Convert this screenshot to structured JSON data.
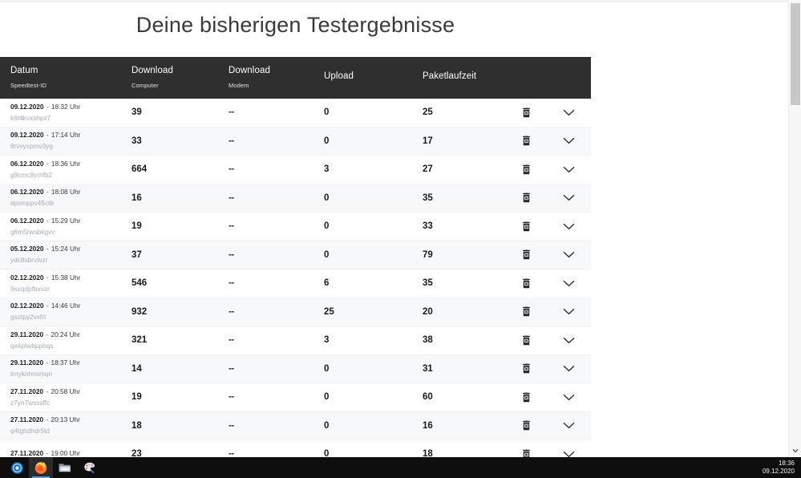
{
  "page": {
    "title": "Deine bisherigen Testergebnisse"
  },
  "table": {
    "headers": [
      {
        "main": "Datum",
        "sub": "Speedtest-ID"
      },
      {
        "main": "Download",
        "sub": "Computer"
      },
      {
        "main": "Download",
        "sub": "Modem"
      },
      {
        "main": "Upload",
        "sub": ""
      },
      {
        "main": "Paketlaufzeit",
        "sub": ""
      }
    ],
    "icons": {
      "delete": "trash-icon",
      "expand": "chevron-down-icon"
    },
    "rows": [
      {
        "date": "09.12.2020",
        "sep": "-",
        "time": "18:32 Uhr",
        "id": "k6t4kvxshpx7",
        "dl_computer": "39",
        "dl_modem": "--",
        "upload": "0",
        "paketlaufzeit": "25"
      },
      {
        "date": "09.12.2020",
        "sep": "-",
        "time": "17:14 Uhr",
        "id": "8rvvyxpmv3yg",
        "dl_computer": "33",
        "dl_modem": "--",
        "upload": "0",
        "paketlaufzeit": "17"
      },
      {
        "date": "06.12.2020",
        "sep": "-",
        "time": "18:36 Uhr",
        "id": "g9cmc9yrhfb2",
        "dl_computer": "664",
        "dl_modem": "--",
        "upload": "3",
        "paketlaufzeit": "27"
      },
      {
        "date": "06.12.2020",
        "sep": "-",
        "time": "18:08 Uhr",
        "id": "dpsmppv45ctb",
        "dl_computer": "16",
        "dl_modem": "--",
        "upload": "0",
        "paketlaufzeit": "35"
      },
      {
        "date": "06.12.2020",
        "sep": "-",
        "time": "15:29 Uhr",
        "id": "g6m5rwsbkgvv",
        "dl_computer": "19",
        "dl_modem": "--",
        "upload": "0",
        "paketlaufzeit": "33"
      },
      {
        "date": "05.12.2020",
        "sep": "-",
        "time": "15:24 Uhr",
        "id": "ydc8xbrvtvzr",
        "dl_computer": "37",
        "dl_modem": "--",
        "upload": "0",
        "paketlaufzeit": "79"
      },
      {
        "date": "02.12.2020",
        "sep": "-",
        "time": "15:38 Uhr",
        "id": "9sxqdpfbxvzr",
        "dl_computer": "546",
        "dl_modem": "--",
        "upload": "6",
        "paketlaufzeit": "35"
      },
      {
        "date": "02.12.2020",
        "sep": "-",
        "time": "14:46 Uhr",
        "id": "gsztpy2vxfrt",
        "dl_computer": "932",
        "dl_modem": "--",
        "upload": "25",
        "paketlaufzeit": "20"
      },
      {
        "date": "29.11.2020",
        "sep": "-",
        "time": "20:24 Uhr",
        "id": "qx4ptwbpphqs",
        "dl_computer": "321",
        "dl_modem": "--",
        "upload": "3",
        "paketlaufzeit": "38"
      },
      {
        "date": "29.11.2020",
        "sep": "-",
        "time": "18:37 Uhr",
        "id": "trnyknhnsmqn",
        "dl_computer": "14",
        "dl_modem": "--",
        "upload": "0",
        "paketlaufzeit": "31"
      },
      {
        "date": "27.11.2020",
        "sep": "-",
        "time": "20:58 Uhr",
        "id": "z7yn7wsssffc",
        "dl_computer": "19",
        "dl_modem": "--",
        "upload": "0",
        "paketlaufzeit": "60"
      },
      {
        "date": "27.11.2020",
        "sep": "-",
        "time": "20:13 Uhr",
        "id": "q4tghdhdr5td",
        "dl_computer": "18",
        "dl_modem": "--",
        "upload": "0",
        "paketlaufzeit": "16"
      },
      {
        "date": "27.11.2020",
        "sep": "-",
        "time": "19:00 Uhr",
        "id": "",
        "dl_computer": "23",
        "dl_modem": "--",
        "upload": "0",
        "paketlaufzeit": "18"
      }
    ]
  },
  "scrollbar": {
    "down_arrow": "chevron-down-icon"
  },
  "taskbar": {
    "items": [
      {
        "name": "cortana-icon",
        "label": ""
      },
      {
        "name": "firefox-icon",
        "label": ""
      },
      {
        "name": "file-explorer-icon",
        "label": ""
      },
      {
        "name": "paint-icon",
        "label": ""
      }
    ],
    "clock": {
      "time": "18:36",
      "date": "09.12.2020"
    }
  },
  "colors": {
    "header_bg": "#2f2f2f",
    "row_alt": "#f7f8fa",
    "taskbar": "#0e0e0e",
    "accent": "#4aa3e0"
  }
}
